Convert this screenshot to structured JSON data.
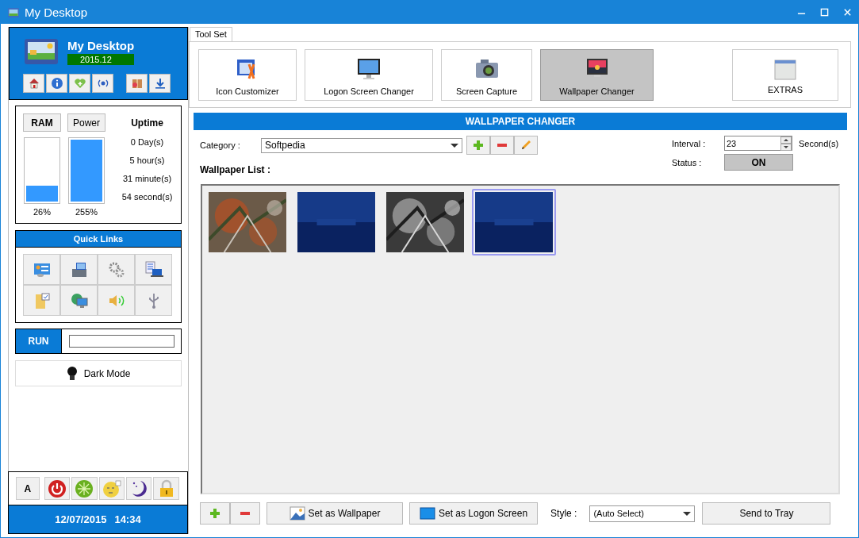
{
  "window": {
    "title": "My Desktop"
  },
  "header": {
    "title": "My Desktop",
    "version": "2015.12"
  },
  "meters": [
    {
      "label": "RAM",
      "selected": true,
      "level": 0.26,
      "reading": "26%"
    },
    {
      "label": "Power",
      "selected": false,
      "level": 1,
      "reading": "255%"
    }
  ],
  "uptime": {
    "title": "Uptime",
    "lines": [
      "0 Day(s)",
      "5 hour(s)",
      "31 minute(s)",
      "54 second(s)"
    ]
  },
  "quick_links": {
    "title": "Quick Links"
  },
  "run": {
    "label": "RUN"
  },
  "dark_mode": {
    "label": "Dark Mode"
  },
  "power_bar": {
    "font_button": "A"
  },
  "clock": {
    "date": "12/07/2015",
    "time": "14:34"
  },
  "toolset": {
    "tab": "Tool Set",
    "tools": [
      {
        "label": "Icon Customizer",
        "selected": false
      },
      {
        "label": "Logon Screen Changer",
        "selected": false
      },
      {
        "label": "Screen Capture",
        "selected": false
      },
      {
        "label": "Wallpaper Changer",
        "selected": true
      }
    ],
    "extras": "EXTRAS"
  },
  "panel": {
    "title": "WALLPAPER CHANGER",
    "category_label": "Category :",
    "category": "Softpedia",
    "interval_label": "Interval :",
    "interval": "23",
    "interval_unit": "Second(s)",
    "status_label": "Status :",
    "status": "ON",
    "list_label": "Wallpaper List :",
    "wallpapers": [
      {
        "kind": "picture",
        "selected": false
      },
      {
        "kind": "picture",
        "selected": false
      },
      {
        "kind": "picture",
        "selected": false
      },
      {
        "kind": "picture",
        "selected": true
      }
    ],
    "actions": [
      "Set as Wallpaper",
      "Set as Logon Screen"
    ],
    "style_label": "Style :",
    "style": "(Auto Select)",
    "tray": "Send to Tray"
  }
}
